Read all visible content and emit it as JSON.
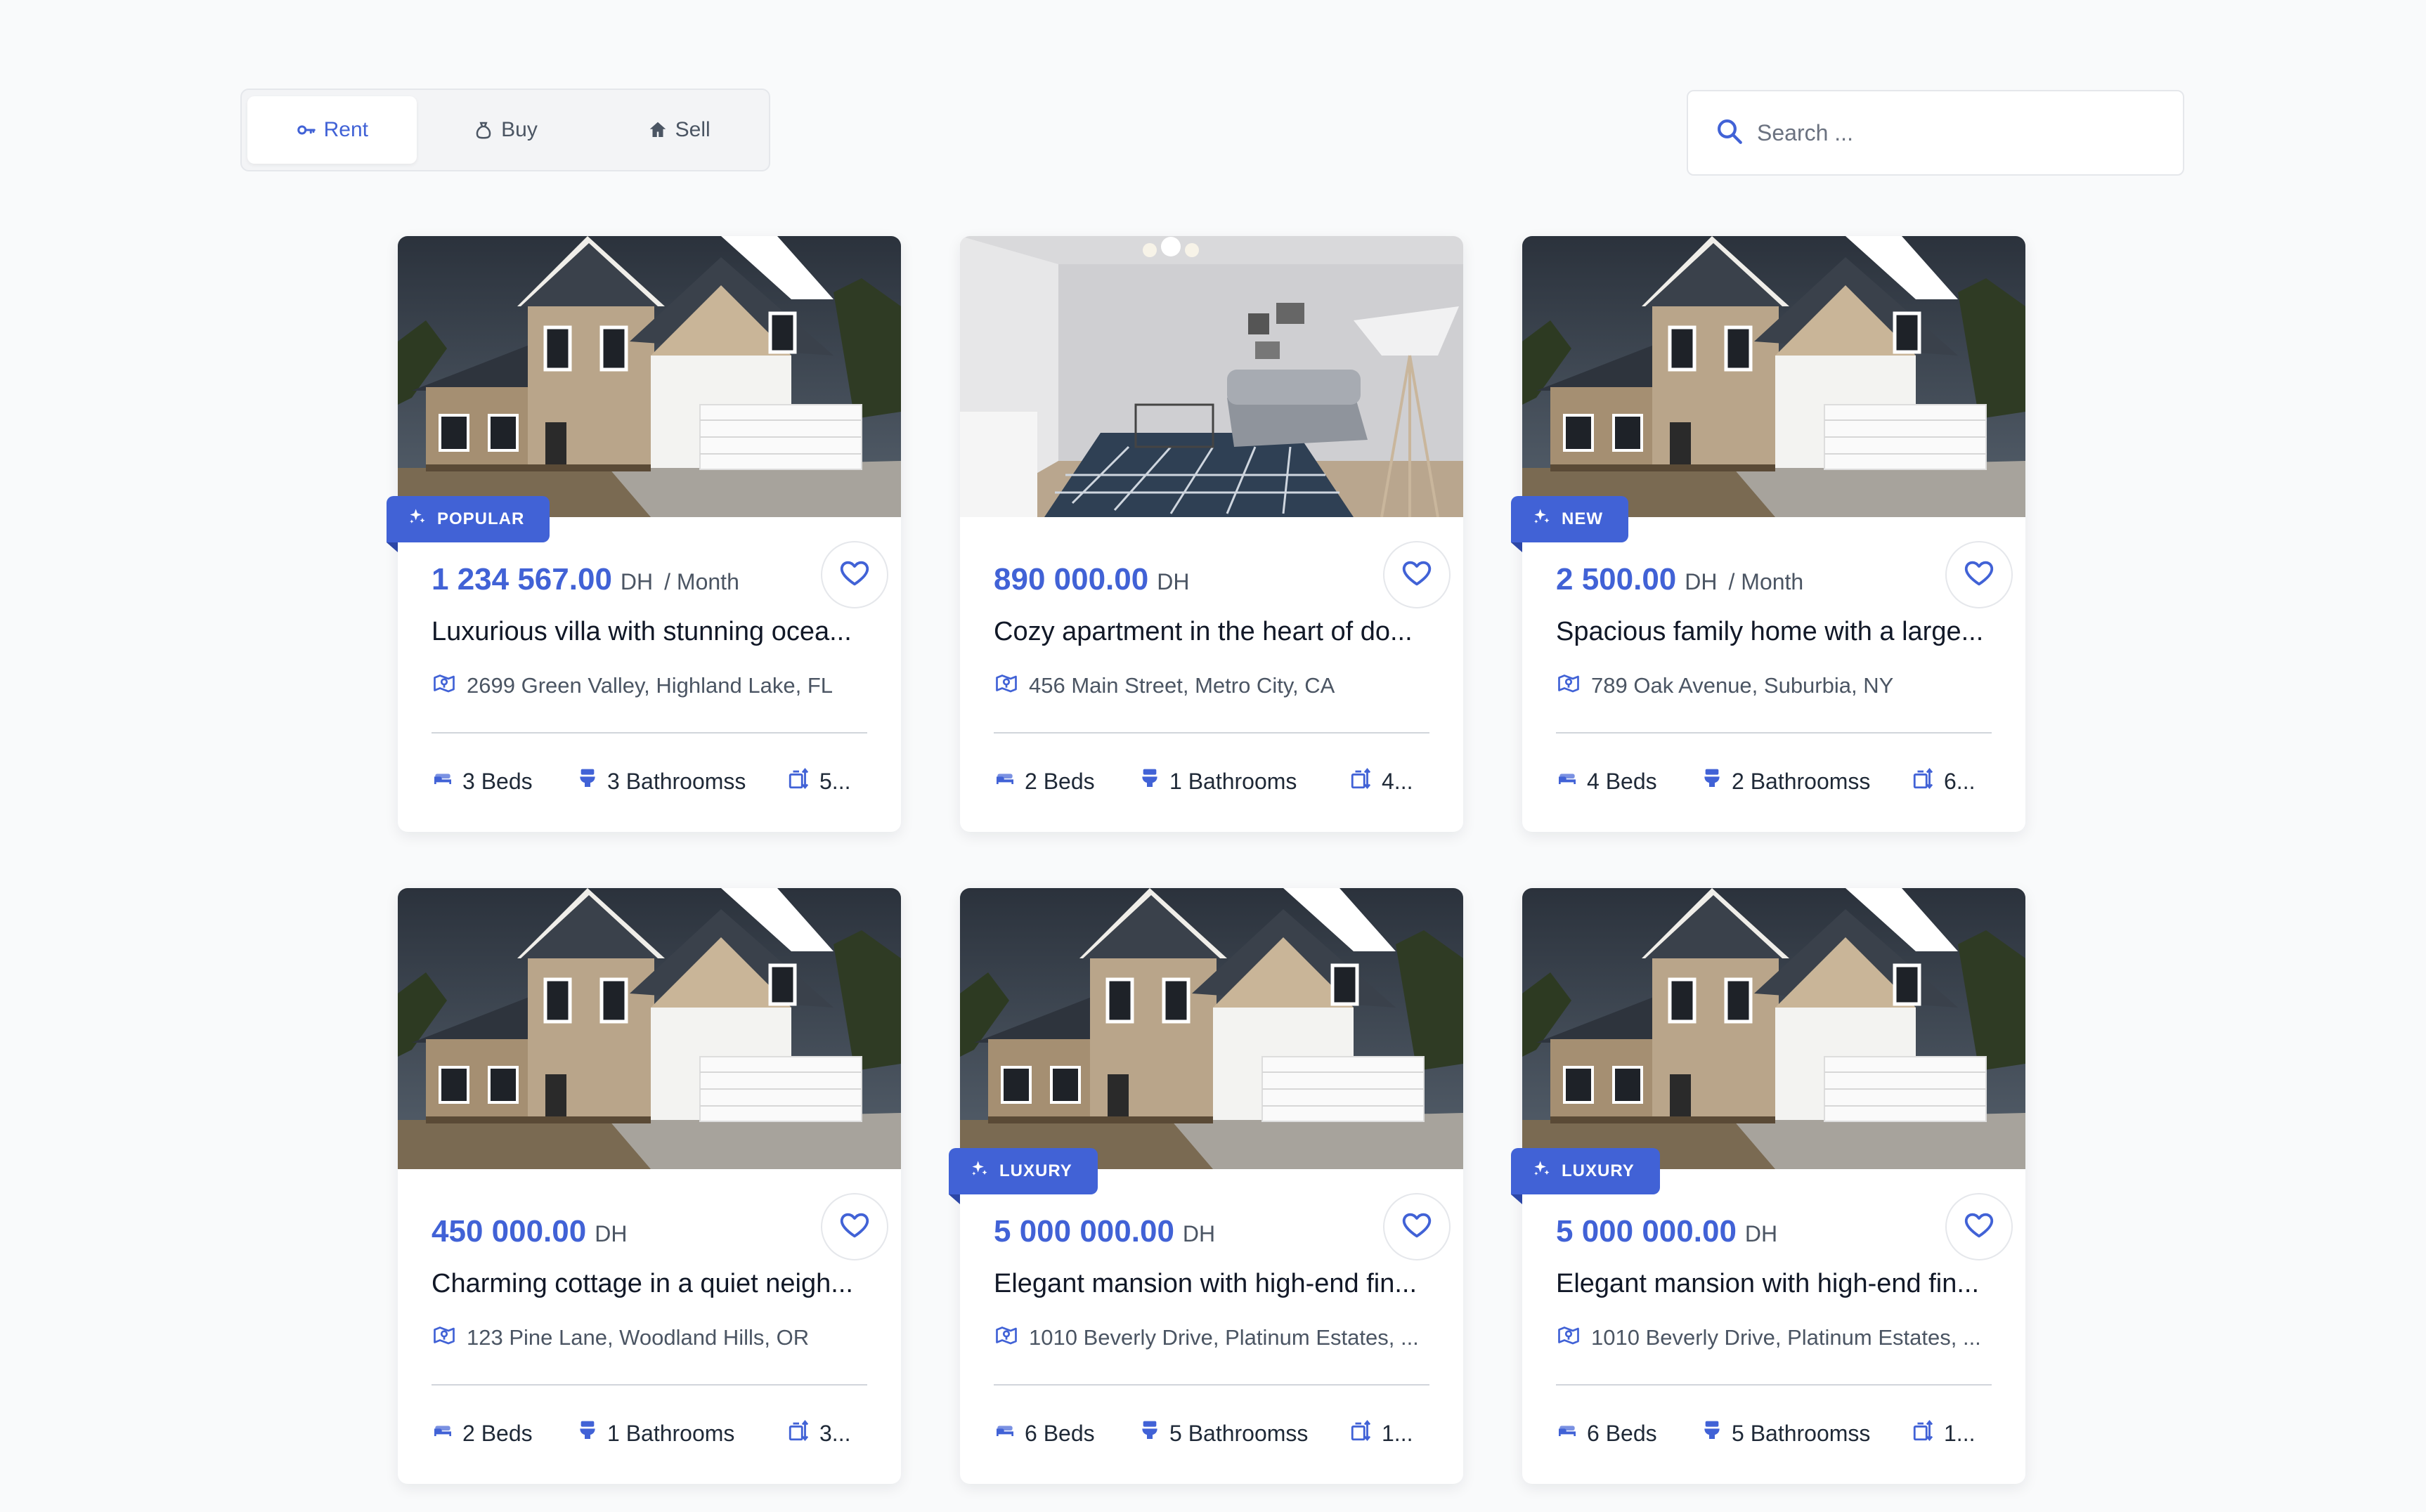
{
  "tabs": [
    {
      "label": "Rent",
      "icon": "key-icon",
      "active": true
    },
    {
      "label": "Buy",
      "icon": "bag-icon",
      "active": false
    },
    {
      "label": "Sell",
      "icon": "home-icon",
      "active": false
    }
  ],
  "search": {
    "placeholder": "Search ..."
  },
  "colors": {
    "accent": "#4162d6",
    "text": "#111827",
    "muted": "#4b5563"
  },
  "listings": [
    {
      "badge": "POPULAR",
      "image": "house-exterior",
      "price": "1 234 567.00",
      "currency": "DH",
      "period": "/ Month",
      "title": "Luxurious villa with stunning ocea...",
      "address": "2699 Green Valley, Highland Lake, FL",
      "beds": "3 Beds",
      "baths": "3 Bathroomss",
      "area": "5..."
    },
    {
      "badge": "",
      "image": "living-room",
      "price": "890 000.00",
      "currency": "DH",
      "period": "",
      "title": "Cozy apartment in the heart of do...",
      "address": "456 Main Street, Metro City, CA",
      "beds": "2 Beds",
      "baths": "1 Bathrooms",
      "area": "4..."
    },
    {
      "badge": "NEW",
      "image": "house-exterior",
      "price": "2 500.00",
      "currency": "DH",
      "period": "/ Month",
      "title": "Spacious family home with a large...",
      "address": "789 Oak Avenue, Suburbia, NY",
      "beds": "4 Beds",
      "baths": "2 Bathroomss",
      "area": "6..."
    },
    {
      "badge": "",
      "image": "house-exterior",
      "price": "450 000.00",
      "currency": "DH",
      "period": "",
      "title": "Charming cottage in a quiet neigh...",
      "address": "123 Pine Lane, Woodland Hills, OR",
      "beds": "2 Beds",
      "baths": "1 Bathrooms",
      "area": "3..."
    },
    {
      "badge": "LUXURY",
      "image": "house-exterior",
      "price": "5 000 000.00",
      "currency": "DH",
      "period": "",
      "title": "Elegant mansion with high-end fin...",
      "address": "1010 Beverly Drive, Platinum Estates, ...",
      "beds": "6 Beds",
      "baths": "5 Bathroomss",
      "area": "1..."
    },
    {
      "badge": "LUXURY",
      "image": "house-exterior",
      "price": "5 000 000.00",
      "currency": "DH",
      "period": "",
      "title": "Elegant mansion with high-end fin...",
      "address": "1010 Beverly Drive, Platinum Estates, ...",
      "beds": "6 Beds",
      "baths": "5 Bathroomss",
      "area": "1..."
    }
  ]
}
